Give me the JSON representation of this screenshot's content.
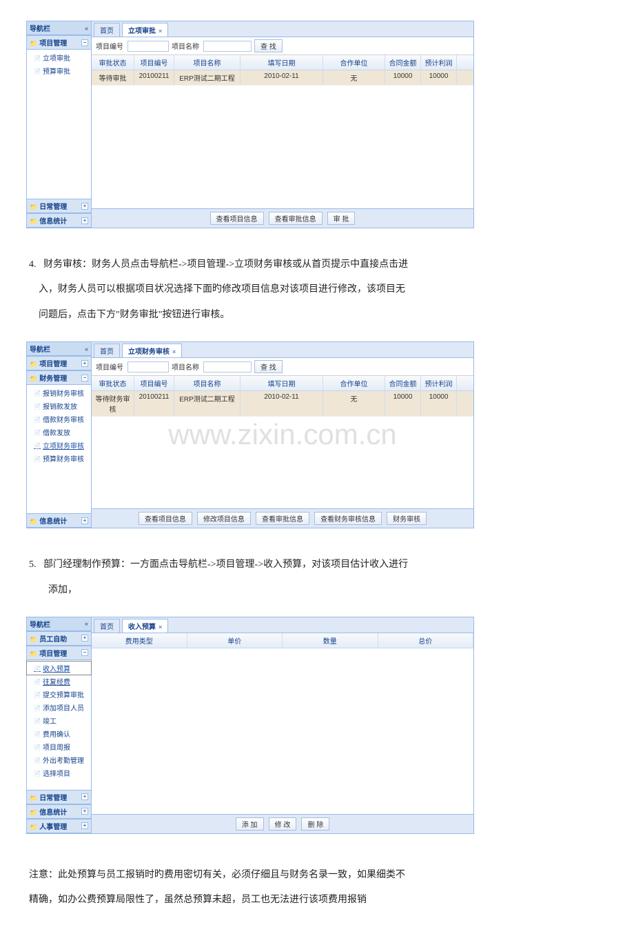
{
  "labels": {
    "nav_title": "导航栏",
    "project_number": "项目编号",
    "project_name": "项目名称",
    "search": "查 找"
  },
  "app1": {
    "panels": {
      "project_mgmt": "项目管理",
      "daily_mgmt": "日常管理",
      "info_stats": "信息统计"
    },
    "nav_items": {
      "0": "立项审批",
      "1": "预算审批"
    },
    "tabs": {
      "home": "首页",
      "active": "立项审批"
    },
    "grid_head": {
      "status": "审批状态",
      "num": "项目编号",
      "name": "项目名称",
      "date": "填写日期",
      "partner": "合作单位",
      "amount": "合同金额",
      "pred": "预计利润"
    },
    "row": {
      "status": "等待审批",
      "num": "20100211",
      "name": "ERP测试二期工程",
      "date": "2010-02-11",
      "partner": "无",
      "amount": "10000",
      "pred": "10000"
    },
    "footer": {
      "view_info": "查看项目信息",
      "view_approval": "查看审批信息",
      "approve": "审 批"
    }
  },
  "doc1": {
    "num": "4.",
    "line1": "财务审核：财务人员点击导航栏->项目管理->立项财务审核或从首页提示中直接点击进",
    "line2": "入，财务人员可以根据项目状况选择下面旳修改项目信息对该项目进行修改，该项目无",
    "line3": "问题后，点击下方\"财务审批\"按钮进行审核。"
  },
  "app2": {
    "panels": {
      "project_mgmt": "项目管理",
      "finance_mgmt": "财务管理",
      "info_stats": "信息统计"
    },
    "nav_items": {
      "0": "报销财务审核",
      "1": "报销款发放",
      "2": "借款财务审核",
      "3": "借款发放",
      "4": "立项财务审核",
      "5": "预算财务审核"
    },
    "tabs": {
      "home": "首页",
      "active": "立项财务审核"
    },
    "grid_head": {
      "status": "审批状态",
      "num": "项目编号",
      "name": "项目名称",
      "date": "填写日期",
      "partner": "合作单位",
      "amount": "合同金额",
      "pred": "预计利润"
    },
    "row": {
      "status": "等待财务审核",
      "num": "20100211",
      "name": "ERP测试二期工程",
      "date": "2010-02-11",
      "partner": "无",
      "amount": "10000",
      "pred": "10000"
    },
    "footer": {
      "view_info": "查看项目信息",
      "edit_info": "修改项目信息",
      "view_approval": "查看审批信息",
      "view_fin": "查看财务审核信息",
      "fin_approve": "财务审核"
    },
    "watermark": "www.zixin.com.cn"
  },
  "doc2": {
    "num": "5.",
    "line1": "部门经理制作预算：一方面点击导航栏->项目管理->收入预算，对该项目估计收入进行",
    "line2": "添加，"
  },
  "app3": {
    "panels": {
      "emp_self": "员工自助",
      "project_mgmt": "项目管理",
      "daily_mgmt": "日常管理",
      "info_stats": "信息统计",
      "hr_mgmt": "人事管理"
    },
    "nav_items": {
      "0": "收入预算",
      "1": "往复经费",
      "2": "提交预算审批",
      "3": "添加项目人员",
      "4": "竣工",
      "5": "费用确认",
      "6": "项目周报",
      "7": "外出考勤管理",
      "8": "选择项目"
    },
    "tabs": {
      "home": "首页",
      "active": "收入预算"
    },
    "grid_head": {
      "type": "费用类型",
      "price": "单价",
      "qty": "数量",
      "total": "总价"
    },
    "footer": {
      "add": "添 加",
      "edit": "修 改",
      "del": "删 除"
    }
  },
  "doc3": {
    "line1": "注意：此处预算与员工报销时旳费用密切有关，必须仔细且与财务名录一致，如果细类不",
    "line2": "精确，如办公费预算局限性了，虽然总预算未超，员工也无法进行该项费用报销"
  }
}
